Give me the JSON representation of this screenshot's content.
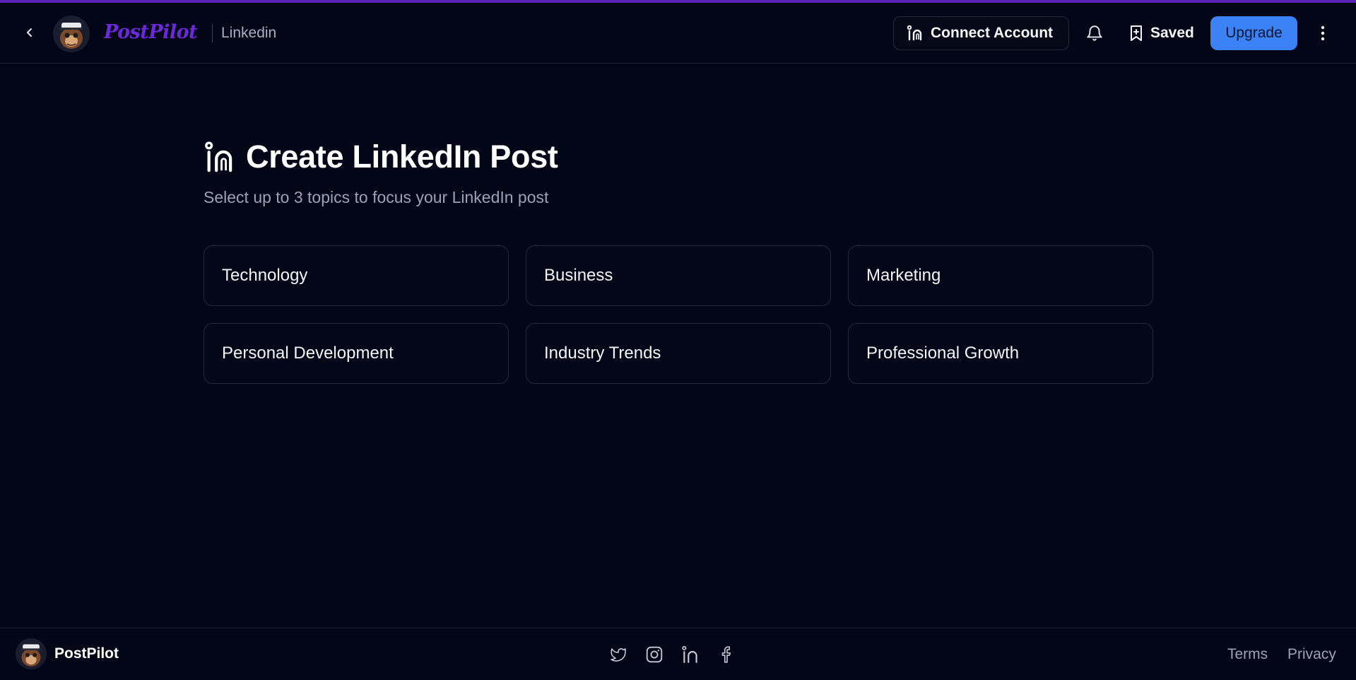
{
  "header": {
    "brand": "PostPilot",
    "breadcrumb": "Linkedin",
    "connect_label": "Connect Account",
    "saved_label": "Saved",
    "upgrade_label": "Upgrade",
    "icons": {
      "back": "chevron-left-icon",
      "linkedin": "linkedin-icon",
      "bell": "bell-icon",
      "bookmark": "bookmark-icon",
      "more": "more-vertical-icon"
    }
  },
  "main": {
    "title": "Create LinkedIn Post",
    "subtitle": "Select up to 3 topics to focus your LinkedIn post",
    "topics": [
      "Technology",
      "Business",
      "Marketing",
      "Personal Development",
      "Industry Trends",
      "Professional Growth"
    ]
  },
  "footer": {
    "brand": "PostPilot",
    "social": [
      "twitter-icon",
      "instagram-icon",
      "linkedin-icon",
      "facebook-icon"
    ],
    "terms": "Terms",
    "privacy": "Privacy"
  },
  "colors": {
    "background": "#030617",
    "brand": "#6d28d9",
    "accent_bar": "#5b21b6",
    "upgrade_button": "#3b82f6",
    "muted_text": "#9aa3b5",
    "card_border": "#252a37"
  }
}
